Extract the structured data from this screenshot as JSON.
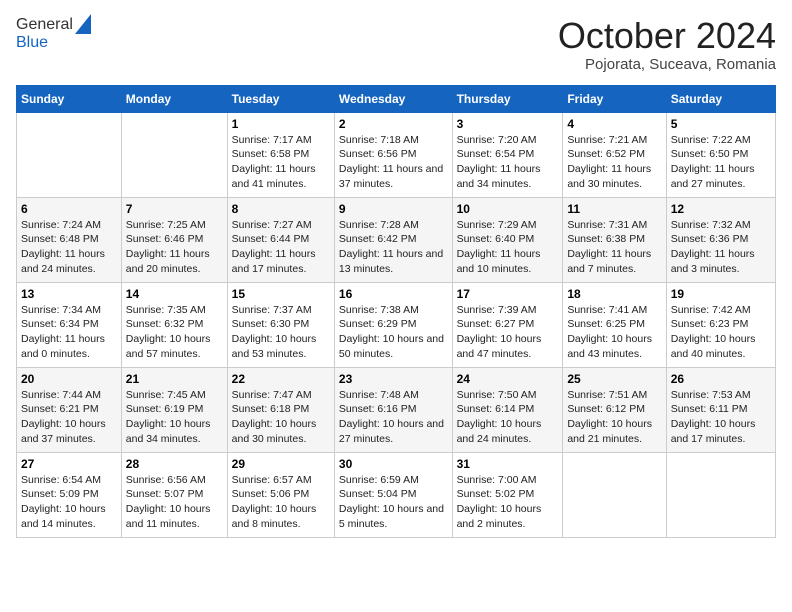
{
  "header": {
    "logo_line1": "General",
    "logo_line2": "Blue",
    "month": "October 2024",
    "location": "Pojorata, Suceava, Romania"
  },
  "weekdays": [
    "Sunday",
    "Monday",
    "Tuesday",
    "Wednesday",
    "Thursday",
    "Friday",
    "Saturday"
  ],
  "weeks": [
    [
      {
        "day": "",
        "info": ""
      },
      {
        "day": "",
        "info": ""
      },
      {
        "day": "1",
        "info": "Sunrise: 7:17 AM\nSunset: 6:58 PM\nDaylight: 11 hours and 41 minutes."
      },
      {
        "day": "2",
        "info": "Sunrise: 7:18 AM\nSunset: 6:56 PM\nDaylight: 11 hours and 37 minutes."
      },
      {
        "day": "3",
        "info": "Sunrise: 7:20 AM\nSunset: 6:54 PM\nDaylight: 11 hours and 34 minutes."
      },
      {
        "day": "4",
        "info": "Sunrise: 7:21 AM\nSunset: 6:52 PM\nDaylight: 11 hours and 30 minutes."
      },
      {
        "day": "5",
        "info": "Sunrise: 7:22 AM\nSunset: 6:50 PM\nDaylight: 11 hours and 27 minutes."
      }
    ],
    [
      {
        "day": "6",
        "info": "Sunrise: 7:24 AM\nSunset: 6:48 PM\nDaylight: 11 hours and 24 minutes."
      },
      {
        "day": "7",
        "info": "Sunrise: 7:25 AM\nSunset: 6:46 PM\nDaylight: 11 hours and 20 minutes."
      },
      {
        "day": "8",
        "info": "Sunrise: 7:27 AM\nSunset: 6:44 PM\nDaylight: 11 hours and 17 minutes."
      },
      {
        "day": "9",
        "info": "Sunrise: 7:28 AM\nSunset: 6:42 PM\nDaylight: 11 hours and 13 minutes."
      },
      {
        "day": "10",
        "info": "Sunrise: 7:29 AM\nSunset: 6:40 PM\nDaylight: 11 hours and 10 minutes."
      },
      {
        "day": "11",
        "info": "Sunrise: 7:31 AM\nSunset: 6:38 PM\nDaylight: 11 hours and 7 minutes."
      },
      {
        "day": "12",
        "info": "Sunrise: 7:32 AM\nSunset: 6:36 PM\nDaylight: 11 hours and 3 minutes."
      }
    ],
    [
      {
        "day": "13",
        "info": "Sunrise: 7:34 AM\nSunset: 6:34 PM\nDaylight: 11 hours and 0 minutes."
      },
      {
        "day": "14",
        "info": "Sunrise: 7:35 AM\nSunset: 6:32 PM\nDaylight: 10 hours and 57 minutes."
      },
      {
        "day": "15",
        "info": "Sunrise: 7:37 AM\nSunset: 6:30 PM\nDaylight: 10 hours and 53 minutes."
      },
      {
        "day": "16",
        "info": "Sunrise: 7:38 AM\nSunset: 6:29 PM\nDaylight: 10 hours and 50 minutes."
      },
      {
        "day": "17",
        "info": "Sunrise: 7:39 AM\nSunset: 6:27 PM\nDaylight: 10 hours and 47 minutes."
      },
      {
        "day": "18",
        "info": "Sunrise: 7:41 AM\nSunset: 6:25 PM\nDaylight: 10 hours and 43 minutes."
      },
      {
        "day": "19",
        "info": "Sunrise: 7:42 AM\nSunset: 6:23 PM\nDaylight: 10 hours and 40 minutes."
      }
    ],
    [
      {
        "day": "20",
        "info": "Sunrise: 7:44 AM\nSunset: 6:21 PM\nDaylight: 10 hours and 37 minutes."
      },
      {
        "day": "21",
        "info": "Sunrise: 7:45 AM\nSunset: 6:19 PM\nDaylight: 10 hours and 34 minutes."
      },
      {
        "day": "22",
        "info": "Sunrise: 7:47 AM\nSunset: 6:18 PM\nDaylight: 10 hours and 30 minutes."
      },
      {
        "day": "23",
        "info": "Sunrise: 7:48 AM\nSunset: 6:16 PM\nDaylight: 10 hours and 27 minutes."
      },
      {
        "day": "24",
        "info": "Sunrise: 7:50 AM\nSunset: 6:14 PM\nDaylight: 10 hours and 24 minutes."
      },
      {
        "day": "25",
        "info": "Sunrise: 7:51 AM\nSunset: 6:12 PM\nDaylight: 10 hours and 21 minutes."
      },
      {
        "day": "26",
        "info": "Sunrise: 7:53 AM\nSunset: 6:11 PM\nDaylight: 10 hours and 17 minutes."
      }
    ],
    [
      {
        "day": "27",
        "info": "Sunrise: 6:54 AM\nSunset: 5:09 PM\nDaylight: 10 hours and 14 minutes."
      },
      {
        "day": "28",
        "info": "Sunrise: 6:56 AM\nSunset: 5:07 PM\nDaylight: 10 hours and 11 minutes."
      },
      {
        "day": "29",
        "info": "Sunrise: 6:57 AM\nSunset: 5:06 PM\nDaylight: 10 hours and 8 minutes."
      },
      {
        "day": "30",
        "info": "Sunrise: 6:59 AM\nSunset: 5:04 PM\nDaylight: 10 hours and 5 minutes."
      },
      {
        "day": "31",
        "info": "Sunrise: 7:00 AM\nSunset: 5:02 PM\nDaylight: 10 hours and 2 minutes."
      },
      {
        "day": "",
        "info": ""
      },
      {
        "day": "",
        "info": ""
      }
    ]
  ]
}
